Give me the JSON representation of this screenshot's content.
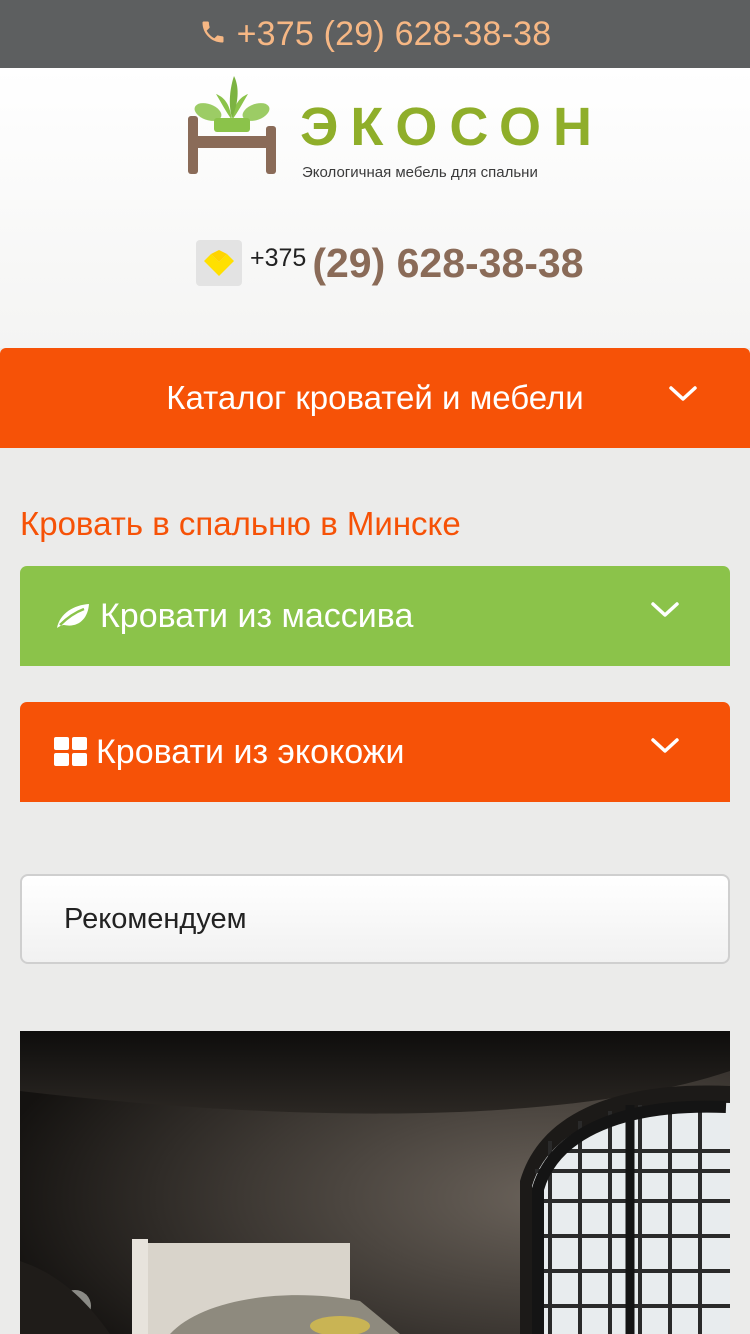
{
  "topbar": {
    "phone": "+375 (29) 628-38-38",
    "icon": "phone-icon"
  },
  "logo": {
    "brand": "ЭКОСОН",
    "tagline": "Экологичная мебель для спальни"
  },
  "contact": {
    "code": "+375",
    "number": "(29) 628-38-38",
    "operator_icon": "velcom-icon"
  },
  "catalog": {
    "label": "Каталог кроватей и мебели"
  },
  "section": {
    "title": "Кровать в спальню в Минске"
  },
  "categories": [
    {
      "label": "Кровати из массива",
      "icon": "leaf-icon",
      "color": "#8bc34a"
    },
    {
      "label": "Кровати из экокожи",
      "icon": "grid-icon",
      "color": "#f65207"
    }
  ],
  "sort": {
    "selected": "Рекомендуем"
  },
  "colors": {
    "accent": "#f65207",
    "green": "#8bc34a",
    "topbar": "#5d5f60",
    "phone_text": "#f6b784"
  }
}
